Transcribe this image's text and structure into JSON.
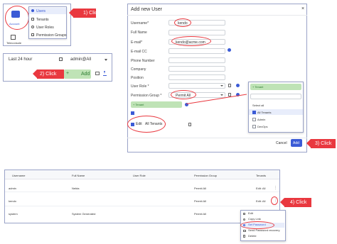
{
  "colors": {
    "accent": "#3b5bd6",
    "callout": "#e9383f",
    "green": "#bfe3b6"
  },
  "nav": {
    "account_label": "Account",
    "teleconsole_label": "Teleconsole",
    "menu": [
      "Users",
      "Tenants",
      "User Roles",
      "Permission Groups"
    ]
  },
  "callouts": [
    "1) Click",
    "2) Click",
    "3) Click",
    "4) Click"
  ],
  "toolbar": {
    "time_range": "Last 24 hour",
    "user_select": "admin@All",
    "add_label": "Add"
  },
  "dialog": {
    "title": "Add new User",
    "fields": [
      {
        "label": "Username*",
        "value": "kendo"
      },
      {
        "label": "Full Name",
        "value": ""
      },
      {
        "label": "E-mail*",
        "value": "kendo@acme.com"
      },
      {
        "label": "E-mail CC",
        "value": ""
      },
      {
        "label": "Phone Number",
        "value": ""
      },
      {
        "label": "Company",
        "value": ""
      },
      {
        "label": "Position",
        "value": ""
      },
      {
        "label": "User Role *",
        "value": ""
      },
      {
        "label": "Permission Group *",
        "value": "Permit All"
      }
    ],
    "tenant_btn": "+ Tenant",
    "edit_label": "Edit",
    "all_tenants_label": "All Tenants",
    "cancel": "Cancel",
    "add": "Add"
  },
  "tenant_dropdown": {
    "button": "+ Tenant",
    "options": [
      {
        "label": "Select all",
        "checked": false
      },
      {
        "label": "All Tenants",
        "checked": true
      },
      {
        "label": "Admin",
        "checked": false
      },
      {
        "label": "DevOps",
        "checked": false
      }
    ]
  },
  "table": {
    "headers": [
      "Username",
      "Full Name",
      "User Role",
      "Permission Group",
      "Tenants"
    ],
    "rows": [
      {
        "username": "admin",
        "full_name": "Nekta",
        "user_role": "",
        "permission_group": "Permit All",
        "tenants": "Edit: All"
      },
      {
        "username": "kendo",
        "full_name": "",
        "user_role": "",
        "permission_group": "Permit All",
        "tenants": "Edit: All"
      },
      {
        "username": "system",
        "full_name": "System Generated",
        "user_role": "",
        "permission_group": "Permit All",
        "tenants": ""
      }
    ]
  },
  "context_menu": [
    "Edit",
    "Copy Link",
    "Set Password",
    "Send Password recovery",
    "Delete"
  ]
}
